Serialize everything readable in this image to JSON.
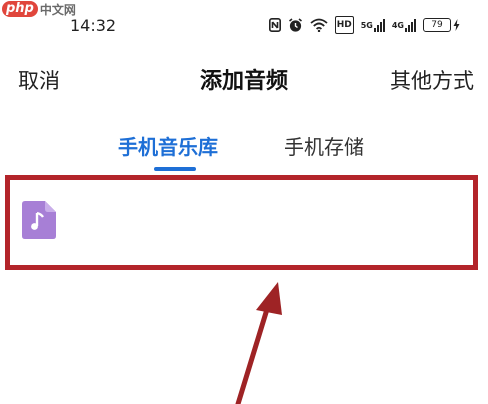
{
  "watermark": {
    "logo": "php",
    "text": "中文网"
  },
  "status_bar": {
    "time": "14:32",
    "icons": [
      "nfc-icon",
      "alarm-icon",
      "wifi-icon",
      "hd-icon",
      "signal-5g-icon",
      "signal-4g-icon",
      "battery-icon"
    ],
    "hd_label": "HD",
    "sim1_label": "5G",
    "sim2_label": "4G",
    "battery_level": "79"
  },
  "header": {
    "cancel_label": "取消",
    "title": "添加音频",
    "other_label": "其他方式"
  },
  "tabs": [
    {
      "label": "手机音乐库",
      "active": true
    },
    {
      "label": "手机存储",
      "active": false
    }
  ],
  "colors": {
    "accent": "#1e6fd6",
    "highlight": "#b3242a",
    "music_icon": "#a77fd6"
  }
}
